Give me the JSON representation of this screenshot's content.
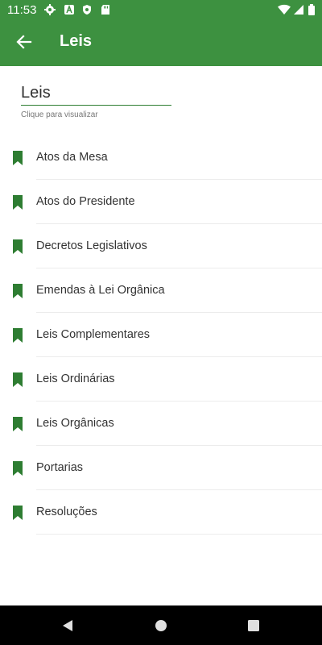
{
  "status": {
    "time": "11:53"
  },
  "appbar": {
    "title": "Leis"
  },
  "search": {
    "value": "Leis",
    "hint": "Clique para visualizar"
  },
  "items": [
    {
      "label": "Atos da Mesa"
    },
    {
      "label": "Atos do Presidente"
    },
    {
      "label": "Decretos Legislativos"
    },
    {
      "label": "Emendas à Lei Orgânica"
    },
    {
      "label": "Leis Complementares"
    },
    {
      "label": "Leis Ordinárias"
    },
    {
      "label": "Leis Orgânicas"
    },
    {
      "label": "Portarias"
    },
    {
      "label": "Resoluções"
    }
  ],
  "colors": {
    "primary": "#3d9140",
    "bookmark": "#2e7d32"
  }
}
